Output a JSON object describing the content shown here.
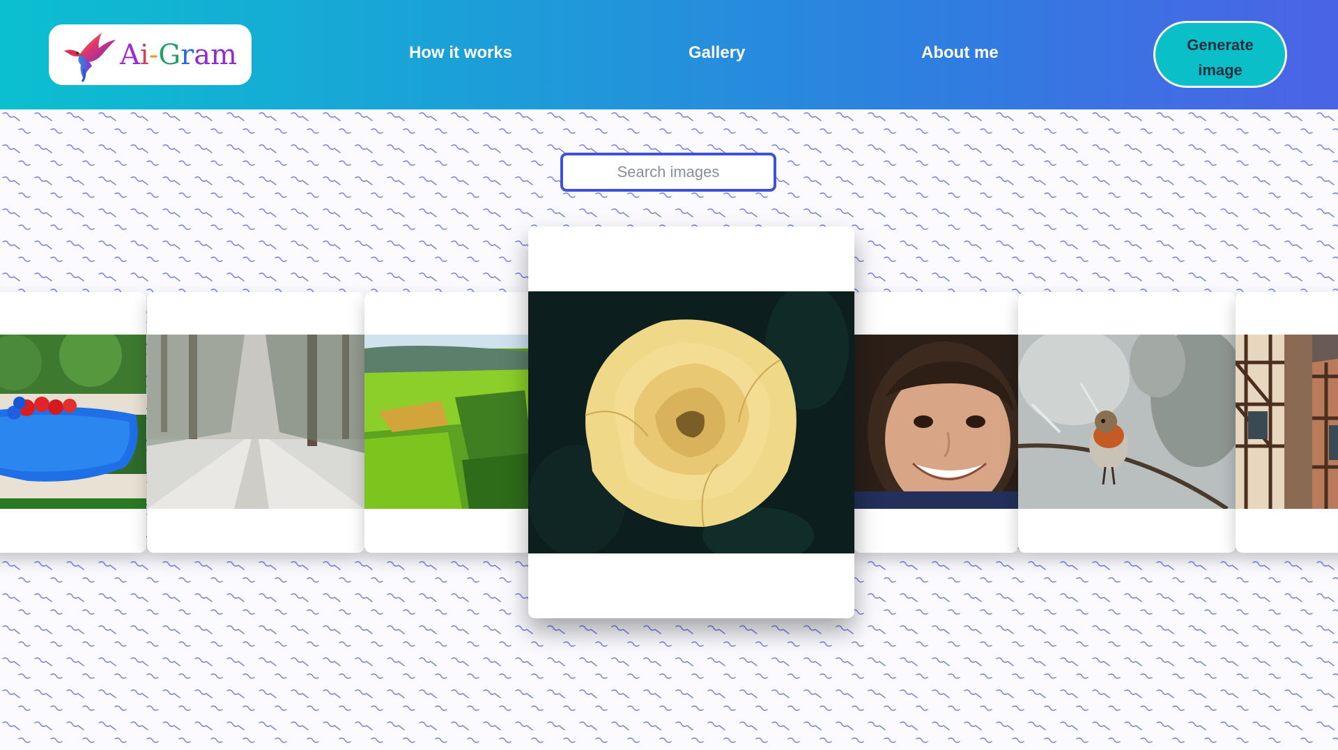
{
  "brand": {
    "name_parts": [
      "A",
      "i",
      "-",
      "G",
      "r",
      "am"
    ],
    "logo_icon": "hummingbird-icon"
  },
  "nav": {
    "how_it_works": "How it works",
    "gallery": "Gallery",
    "about_me": "About me"
  },
  "cta": {
    "line1": "Generate",
    "line2": "image"
  },
  "search": {
    "placeholder": "Search images",
    "value": ""
  },
  "carousel": {
    "items": [
      {
        "subject": "pool-with-balloons",
        "active": false
      },
      {
        "subject": "snowy-forest-road",
        "active": false
      },
      {
        "subject": "green-aerial-fields",
        "active": false
      },
      {
        "subject": "yellow-rose",
        "active": true
      },
      {
        "subject": "smiling-child",
        "active": false
      },
      {
        "subject": "robin-on-branch",
        "active": false
      },
      {
        "subject": "half-timbered-houses",
        "active": false
      }
    ]
  },
  "colors": {
    "header_start": "#0bbfd0",
    "header_end": "#4b63e6",
    "cta_bg": "#0bbfc9",
    "search_border": "#3f51d6",
    "pattern": "#7a86e6"
  }
}
